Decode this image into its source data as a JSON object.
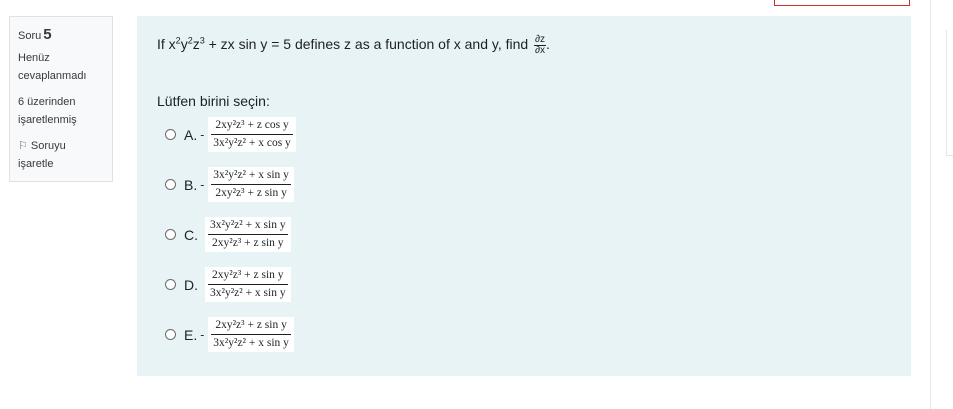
{
  "sidebar": {
    "question_label": "Soru",
    "question_number": "5",
    "state": "Henüz cevaplanmadı",
    "grade": "6 üzerinden işaretlenmiş",
    "flag_label": "Soruyu işaretle"
  },
  "question": {
    "prefix": "If x",
    "mid": " + zx sin y = 5 defines z as a function of x and y, find ",
    "frac_num": "∂z",
    "frac_den": "∂x",
    "suffix": ".",
    "prompt": "Lütfen birini seçin:"
  },
  "options": [
    {
      "letter": "A.",
      "sign": "-",
      "num": "2xy²z³ + z cos y",
      "den": "3x²y²z² + x cos y"
    },
    {
      "letter": "B.",
      "sign": "-",
      "num": "3x²y²z² + x sin y",
      "den": "2xy²z³ + z sin y"
    },
    {
      "letter": "C.",
      "sign": "",
      "num": "3x²y²z² + x sin y",
      "den": "2xy²z³ + z sin y"
    },
    {
      "letter": "D.",
      "sign": "",
      "num": "2xy²z³ + z sin y",
      "den": "3x²y²z² + x sin y"
    },
    {
      "letter": "E.",
      "sign": "-",
      "num": "2xy²z³ + z sin y",
      "den": "3x²y²z² + x sin y"
    }
  ]
}
